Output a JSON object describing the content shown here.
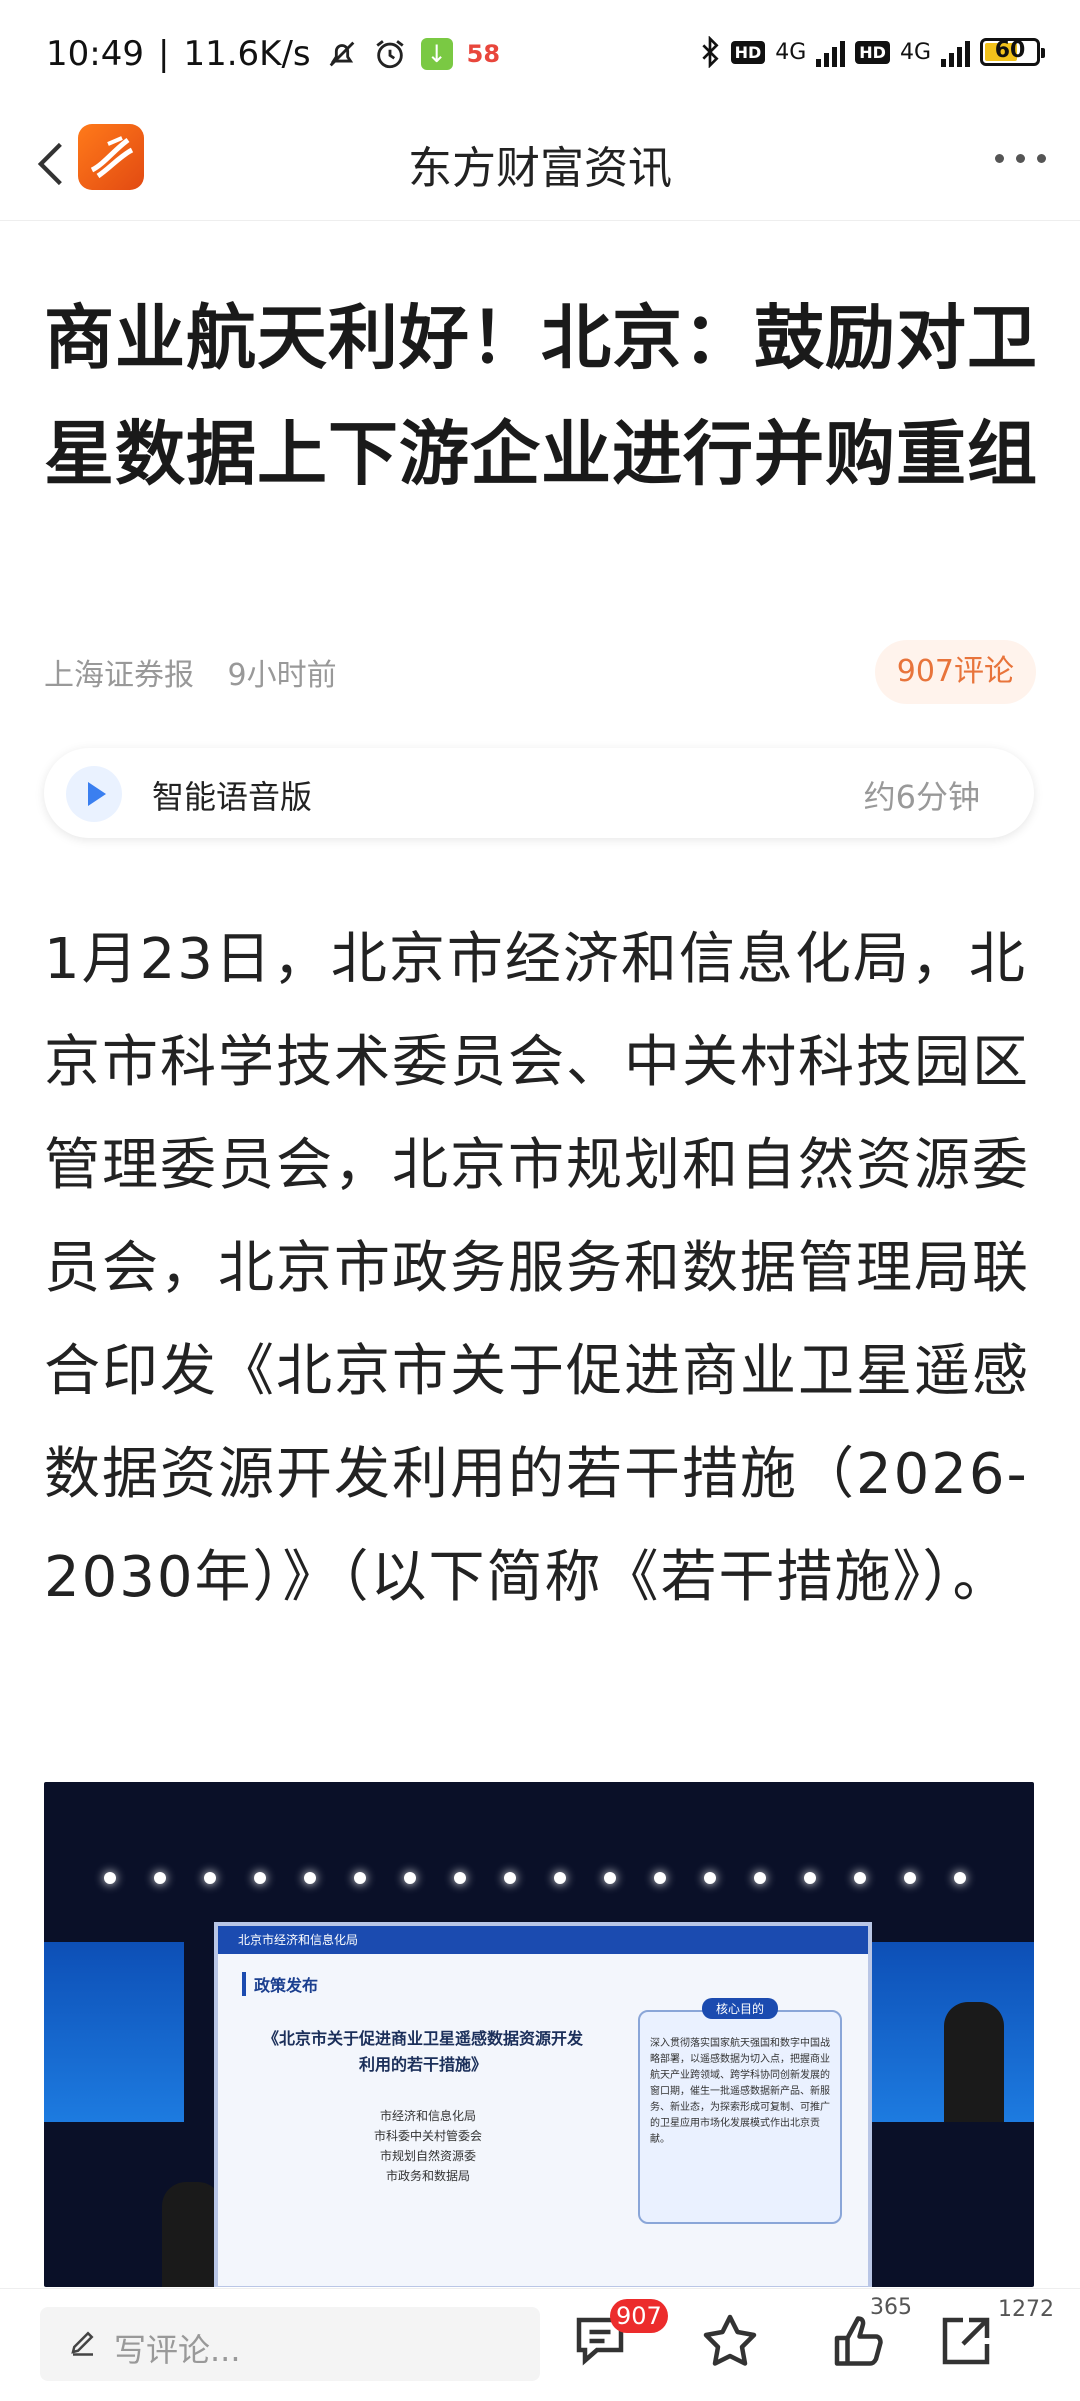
{
  "status_bar": {
    "time": "10:49",
    "speed": "11.6K/s",
    "app_badge": "58",
    "hd1": "HD",
    "net1": "4G",
    "hd2": "HD",
    "net2": "4G",
    "battery": "60"
  },
  "header": {
    "title": "东方财富资讯"
  },
  "article": {
    "title": "商业航天利好！北京：鼓励对卫星数据上下游企业进行并购重组",
    "source": "上海证券报",
    "time_ago": "9小时前",
    "comment_pill": "907评论",
    "audio": {
      "label": "智能语音版",
      "duration": "约6分钟"
    },
    "body": "1月23日，北京市经济和信息化局，北京市科学技术委员会、中关村科技园区管理委员会，北京市规划和自然资源委员会，北京市政务服务和数据管理局联合印发《北京市关于促进商业卫星遥感数据资源开发利用的若干措施（2026-2030年）》（以下简称《若干措施》）。",
    "image": {
      "org": "北京市经济和信息化局",
      "section": "政策发布",
      "doc_title": "《北京市关于促进商业卫星遥感数据资源开发利用的若干措施》",
      "units": [
        "市经济和信息化局",
        "市科委中关村管委会",
        "市规划自然资源委",
        "市政务和数据局"
      ],
      "box_label": "核心目的",
      "box_text": "深入贯彻落实国家航天强国和数字中国战略部署，以遥感数据为切入点，把握商业航天产业跨领域、跨学科协同创新发展的窗口期，催生一批遥感数据新产品、新服务、新业态，为探索形成可复制、可推广的卫星应用市场化发展模式作出北京贡献。"
    }
  },
  "bottom_bar": {
    "comment_placeholder": "写评论...",
    "comment_badge": "907",
    "like_count": "365",
    "share_count": "1272"
  }
}
